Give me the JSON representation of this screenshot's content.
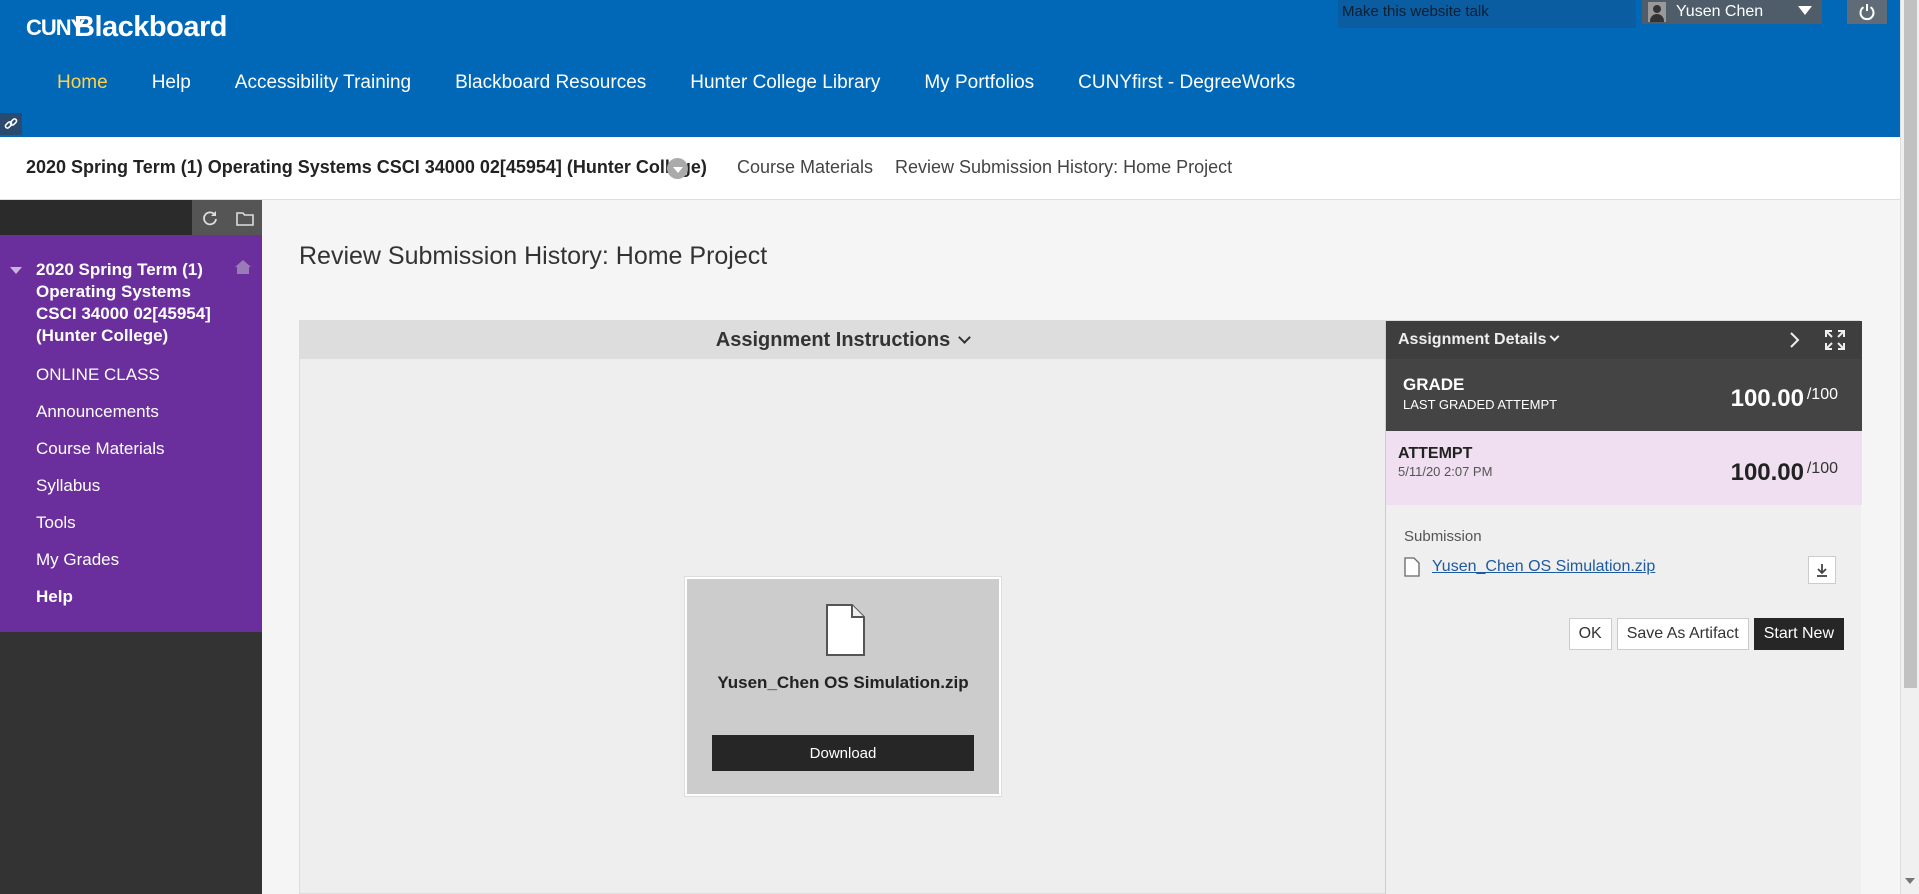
{
  "header": {
    "logo_mark": "CUNY",
    "logo_word": "Blackboard",
    "talk_label": "Make this website talk",
    "user_name": "Yusen Chen",
    "nav": [
      {
        "label": "Home"
      },
      {
        "label": "Help"
      },
      {
        "label": "Accessibility Training"
      },
      {
        "label": "Blackboard Resources"
      },
      {
        "label": "Hunter College Library"
      },
      {
        "label": "My Portfolios"
      },
      {
        "label": "CUNYfirst - DegreeWorks"
      }
    ]
  },
  "breadcrumb": {
    "course": "2020 Spring Term (1) Operating Systems CSCI 34000 02[45954] (Hunter College)",
    "section": "Course Materials",
    "current": "Review Submission History: Home Project"
  },
  "sidebar": {
    "course_title": "2020 Spring Term (1) Operating Systems CSCI 34000 02[45954] (Hunter College)",
    "items": [
      {
        "label": "ONLINE CLASS"
      },
      {
        "label": "Announcements"
      },
      {
        "label": "Course Materials"
      },
      {
        "label": "Syllabus"
      },
      {
        "label": "Tools"
      },
      {
        "label": "My Grades"
      },
      {
        "label": "Help"
      }
    ]
  },
  "main": {
    "heading": "Review Submission History: Home Project",
    "instructions_label": "Assignment Instructions",
    "file_name": "Yusen_Chen OS Simulation.zip",
    "download_label": "Download"
  },
  "details": {
    "title": "Assignment Details",
    "grade_label": "GRADE",
    "grade_sub": "LAST GRADED ATTEMPT",
    "grade_score": "100.00",
    "grade_max": "/100",
    "attempt_label": "ATTEMPT",
    "attempt_date": "5/11/20 2:07 PM",
    "attempt_score": "100.00",
    "attempt_max": "/100",
    "submission_label": "Submission",
    "submission_file": "Yusen_Chen OS Simulation.zip",
    "ok_label": "OK",
    "artifact_label": "Save As Artifact",
    "start_new_label": "Start New"
  },
  "colors": {
    "header_blue": "#0068b6",
    "active_tab": "#ffd24a",
    "course_menu_purple": "#6a2f9c",
    "attempt_bg": "#efdff0",
    "grade_bg": "#444444"
  }
}
